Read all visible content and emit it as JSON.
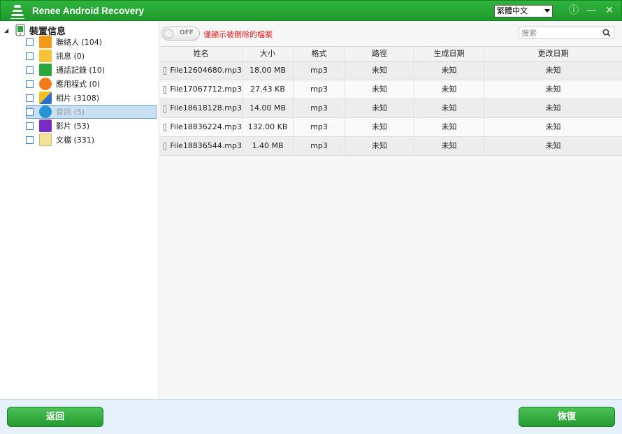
{
  "window": {
    "title": "Renee Android Recovery",
    "language": "繁體中文",
    "info_glyph": "ⓘ",
    "minimize_glyph": "—",
    "close_glyph": "✕",
    "accent": "#23a532"
  },
  "sidebar": {
    "root_label": "裝置信息",
    "items": [
      {
        "label": "聯絡人 (104)",
        "icon": "contacts-icon",
        "color": "#f39a1a"
      },
      {
        "label": "訊息 (0)",
        "icon": "message-icon",
        "color": "#f5c436"
      },
      {
        "label": "通話記錄 (10)",
        "icon": "phone-icon",
        "color": "#2aa63c"
      },
      {
        "label": "應用程式 (0)",
        "icon": "app-icon",
        "color": "#f07d18"
      },
      {
        "label": "相片 (3108)",
        "icon": "photo-icon",
        "color": "#2c6fd1"
      },
      {
        "label": "音訊 (5)",
        "icon": "audio-icon",
        "color": "#2a93d6"
      },
      {
        "label": "影片 (53)",
        "icon": "video-icon",
        "color": "#7a2bc2"
      },
      {
        "label": "文檔 (331)",
        "icon": "document-icon",
        "color": "#f3e39a"
      }
    ]
  },
  "toolbar": {
    "toggle_label": "OFF",
    "filter_text": "僅顯示被刪除的檔案",
    "search_placeholder": "搜索"
  },
  "table": {
    "columns": [
      "姓名",
      "大小",
      "格式",
      "路徑",
      "生成日期",
      "更改日期"
    ],
    "rows": [
      [
        "File12604680.mp3",
        "18.00 MB",
        "mp3",
        "未知",
        "未知",
        "未知"
      ],
      [
        "File17067712.mp3",
        "27.43 KB",
        "mp3",
        "未知",
        "未知",
        "未知"
      ],
      [
        "File18618128.mp3",
        "14.00 MB",
        "mp3",
        "未知",
        "未知",
        "未知"
      ],
      [
        "File18836224.mp3",
        "132.00 KB",
        "mp3",
        "未知",
        "未知",
        "未知"
      ],
      [
        "File18836544.mp3",
        "1.40 MB",
        "mp3",
        "未知",
        "未知",
        "未知"
      ]
    ]
  },
  "footer": {
    "back_label": "返回",
    "recover_label": "恢復"
  }
}
